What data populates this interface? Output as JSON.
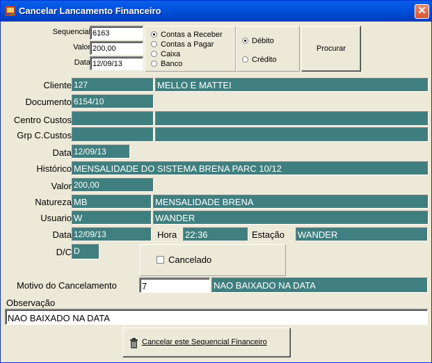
{
  "window": {
    "title": "Cancelar Lancamento Financeiro"
  },
  "search": {
    "sequencial_label": "Sequencial",
    "sequencial_value": "6163",
    "valor_label": "Valor",
    "valor_value": "200,00",
    "data_label": "Data",
    "data_value": "12/09/13",
    "account_options": [
      {
        "label": "Contas a Receber",
        "selected": true
      },
      {
        "label": "Contas a Pagar",
        "selected": false
      },
      {
        "label": "Caixa",
        "selected": false
      },
      {
        "label": "Banco",
        "selected": false
      }
    ],
    "dc_options": [
      {
        "label": "Débito",
        "selected": true
      },
      {
        "label": "Crédito",
        "selected": false
      }
    ],
    "search_button": "Procurar"
  },
  "details": {
    "cliente_label": "Cliente",
    "cliente_code": "127",
    "cliente_name": "MELLO E MATTEI",
    "documento_label": "Documento",
    "documento_value": "6154/10",
    "centro_custos_label": "Centro Custos",
    "centro_custos_code": "",
    "centro_custos_name": "",
    "grp_custos_label": "Grp C.Custos",
    "grp_custos_code": "",
    "grp_custos_name": "",
    "data_label": "Data",
    "data_value": "12/09/13",
    "historico_label": "Histórico",
    "historico_value": "MENSALIDADE DO SISTEMA BRENA PARC 10/12",
    "valor_label": "Valor",
    "valor_value": "200,00",
    "natureza_label": "Natureza",
    "natureza_code": "MB",
    "natureza_name": "MENSALIDADE BRENA",
    "usuario_label": "Usuario",
    "usuario_code": "W",
    "usuario_name": "WANDER",
    "data2_label": "Data",
    "data2_value": "12/09/13",
    "hora_label": "Hora",
    "hora_value": "22:36",
    "estacao_label": "Estação",
    "estacao_value": "WANDER",
    "dc_label": "D/C",
    "dc_value": "D",
    "cancelado_label": "Cancelado",
    "cancelado_checked": false
  },
  "cancel": {
    "motivo_label": "Motivo do Cancelamento",
    "motivo_code": "7",
    "motivo_desc": "NAO BAIXADO NA DATA",
    "observacao_label": "Observação",
    "observacao_value": "NAO BAIXADO NA DATA",
    "cancel_button": "Cancelar este Sequencial Financeiro"
  },
  "colors": {
    "field_teal": "#3f7f7f",
    "title_blue": "#0053e0",
    "close_red": "#d9532f"
  }
}
